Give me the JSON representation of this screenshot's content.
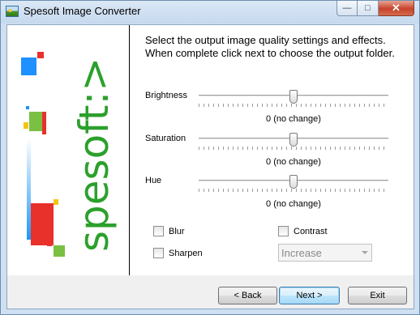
{
  "window": {
    "title": "Spesoft Image Converter",
    "icon": "image-landscape-icon",
    "controls": {
      "minimize": "minimize-icon",
      "maximize": "maximize-icon",
      "close": "close-icon"
    }
  },
  "sidebar": {
    "logo_text": "spesoft:>",
    "logo_color": "#2ca02c"
  },
  "main": {
    "instructions": "Select the output image quality settings and effects. When complete click next to choose the output folder.",
    "sliders": [
      {
        "label": "Brightness",
        "value_text": "0 (no change)",
        "position": 0.5
      },
      {
        "label": "Saturation",
        "value_text": "0 (no change)",
        "position": 0.5
      },
      {
        "label": "Hue",
        "value_text": "0 (no change)",
        "position": 0.5
      }
    ],
    "checkboxes": {
      "blur": {
        "label": "Blur",
        "checked": false
      },
      "sharpen": {
        "label": "Sharpen",
        "checked": false
      },
      "contrast": {
        "label": "Contrast",
        "checked": false
      }
    },
    "contrast_select": {
      "value": "Increase",
      "enabled": false
    }
  },
  "footer": {
    "back_label": "< Back",
    "next_label": "Next >",
    "exit_label": "Exit"
  }
}
